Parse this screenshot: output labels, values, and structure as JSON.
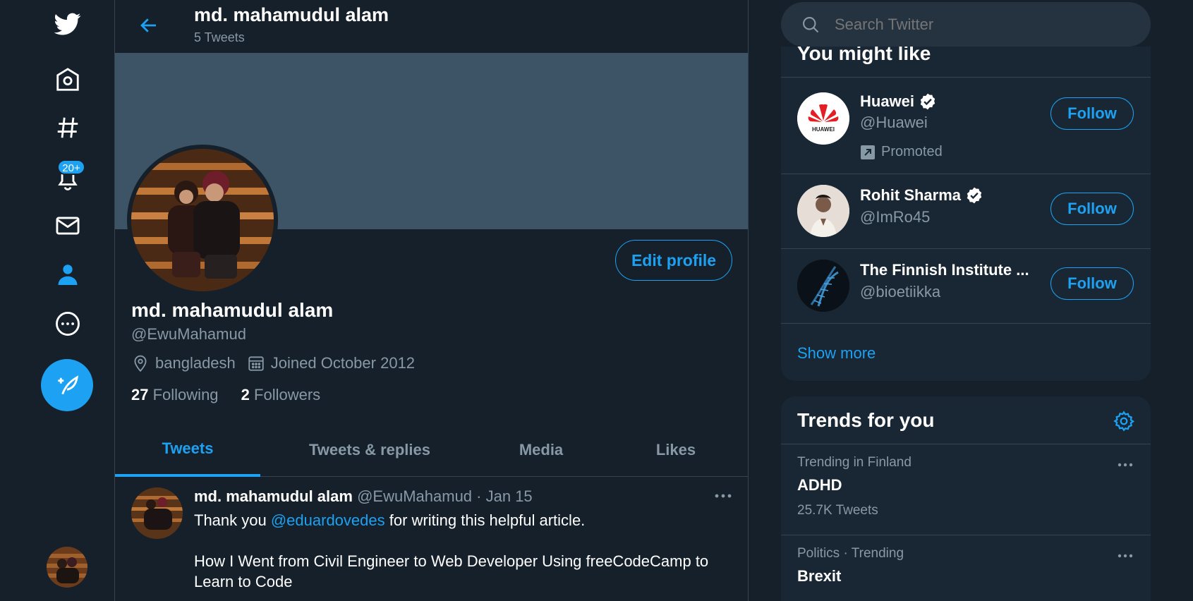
{
  "nav": {
    "notifications_badge": "20+",
    "icons": [
      "twitter-logo-icon",
      "home-icon",
      "explore-hashtag-icon",
      "notifications-bell-icon",
      "messages-envelope-icon",
      "profile-person-icon",
      "more-icon",
      "compose-tweet-icon"
    ]
  },
  "header": {
    "name": "md. mahamudul alam",
    "tweet_count": "5 Tweets"
  },
  "profile": {
    "edit_label": "Edit profile",
    "name": "md. mahamudul alam",
    "handle": "@EwuMahamud",
    "location": "bangladesh",
    "joined": "Joined October 2012",
    "following_count": "27",
    "following_label": "Following",
    "followers_count": "2",
    "followers_label": "Followers"
  },
  "tabs": [
    "Tweets",
    "Tweets & replies",
    "Media",
    "Likes"
  ],
  "tweet": {
    "name": "md. mahamudul alam",
    "handle": "@EwuMahamud",
    "date": "· Jan 15",
    "text_before": "Thank you ",
    "mention": "@eduardovedes",
    "text_after": " for writing this helpful article.",
    "text_body": "How I Went from Civil Engineer to Web Developer Using freeCodeCamp to Learn to Code"
  },
  "search": {
    "placeholder": "Search Twitter"
  },
  "might_like": {
    "title": "You might like",
    "users": [
      {
        "name": "Huawei",
        "handle": "@Huawei",
        "verified": true,
        "promoted": "Promoted",
        "follow": "Follow"
      },
      {
        "name": "Rohit Sharma",
        "handle": "@ImRo45",
        "verified": true,
        "follow": "Follow"
      },
      {
        "name": "The Finnish Institute ...",
        "handle": "@bioetiikka",
        "verified": false,
        "follow": "Follow"
      }
    ],
    "show_more": "Show more"
  },
  "trends": {
    "title": "Trends for you",
    "items": [
      {
        "context": "Trending in Finland",
        "name": "ADHD",
        "count": "25.7K Tweets"
      },
      {
        "context": "Politics · Trending",
        "name": "Brexit"
      }
    ]
  },
  "colors": {
    "background": "#15202b",
    "panel": "#192734",
    "accent": "#1da1f2",
    "muted": "#8899a6",
    "border": "#38444d"
  }
}
